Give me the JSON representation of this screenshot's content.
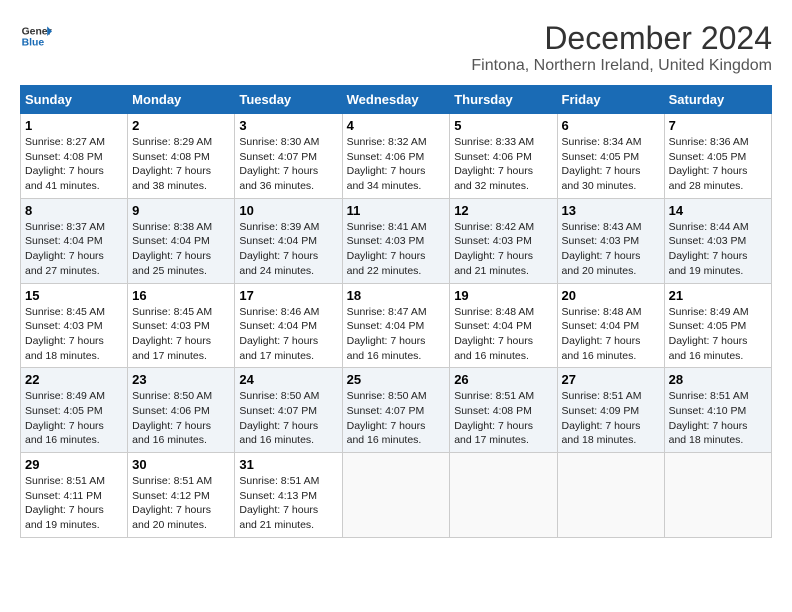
{
  "header": {
    "logo_general": "General",
    "logo_blue": "Blue",
    "month_title": "December 2024",
    "subtitle": "Fintona, Northern Ireland, United Kingdom"
  },
  "weekdays": [
    "Sunday",
    "Monday",
    "Tuesday",
    "Wednesday",
    "Thursday",
    "Friday",
    "Saturday"
  ],
  "weeks": [
    [
      {
        "day": "1",
        "sunrise": "Sunrise: 8:27 AM",
        "sunset": "Sunset: 4:08 PM",
        "daylight": "Daylight: 7 hours and 41 minutes."
      },
      {
        "day": "2",
        "sunrise": "Sunrise: 8:29 AM",
        "sunset": "Sunset: 4:08 PM",
        "daylight": "Daylight: 7 hours and 38 minutes."
      },
      {
        "day": "3",
        "sunrise": "Sunrise: 8:30 AM",
        "sunset": "Sunset: 4:07 PM",
        "daylight": "Daylight: 7 hours and 36 minutes."
      },
      {
        "day": "4",
        "sunrise": "Sunrise: 8:32 AM",
        "sunset": "Sunset: 4:06 PM",
        "daylight": "Daylight: 7 hours and 34 minutes."
      },
      {
        "day": "5",
        "sunrise": "Sunrise: 8:33 AM",
        "sunset": "Sunset: 4:06 PM",
        "daylight": "Daylight: 7 hours and 32 minutes."
      },
      {
        "day": "6",
        "sunrise": "Sunrise: 8:34 AM",
        "sunset": "Sunset: 4:05 PM",
        "daylight": "Daylight: 7 hours and 30 minutes."
      },
      {
        "day": "7",
        "sunrise": "Sunrise: 8:36 AM",
        "sunset": "Sunset: 4:05 PM",
        "daylight": "Daylight: 7 hours and 28 minutes."
      }
    ],
    [
      {
        "day": "8",
        "sunrise": "Sunrise: 8:37 AM",
        "sunset": "Sunset: 4:04 PM",
        "daylight": "Daylight: 7 hours and 27 minutes."
      },
      {
        "day": "9",
        "sunrise": "Sunrise: 8:38 AM",
        "sunset": "Sunset: 4:04 PM",
        "daylight": "Daylight: 7 hours and 25 minutes."
      },
      {
        "day": "10",
        "sunrise": "Sunrise: 8:39 AM",
        "sunset": "Sunset: 4:04 PM",
        "daylight": "Daylight: 7 hours and 24 minutes."
      },
      {
        "day": "11",
        "sunrise": "Sunrise: 8:41 AM",
        "sunset": "Sunset: 4:03 PM",
        "daylight": "Daylight: 7 hours and 22 minutes."
      },
      {
        "day": "12",
        "sunrise": "Sunrise: 8:42 AM",
        "sunset": "Sunset: 4:03 PM",
        "daylight": "Daylight: 7 hours and 21 minutes."
      },
      {
        "day": "13",
        "sunrise": "Sunrise: 8:43 AM",
        "sunset": "Sunset: 4:03 PM",
        "daylight": "Daylight: 7 hours and 20 minutes."
      },
      {
        "day": "14",
        "sunrise": "Sunrise: 8:44 AM",
        "sunset": "Sunset: 4:03 PM",
        "daylight": "Daylight: 7 hours and 19 minutes."
      }
    ],
    [
      {
        "day": "15",
        "sunrise": "Sunrise: 8:45 AM",
        "sunset": "Sunset: 4:03 PM",
        "daylight": "Daylight: 7 hours and 18 minutes."
      },
      {
        "day": "16",
        "sunrise": "Sunrise: 8:45 AM",
        "sunset": "Sunset: 4:03 PM",
        "daylight": "Daylight: 7 hours and 17 minutes."
      },
      {
        "day": "17",
        "sunrise": "Sunrise: 8:46 AM",
        "sunset": "Sunset: 4:04 PM",
        "daylight": "Daylight: 7 hours and 17 minutes."
      },
      {
        "day": "18",
        "sunrise": "Sunrise: 8:47 AM",
        "sunset": "Sunset: 4:04 PM",
        "daylight": "Daylight: 7 hours and 16 minutes."
      },
      {
        "day": "19",
        "sunrise": "Sunrise: 8:48 AM",
        "sunset": "Sunset: 4:04 PM",
        "daylight": "Daylight: 7 hours and 16 minutes."
      },
      {
        "day": "20",
        "sunrise": "Sunrise: 8:48 AM",
        "sunset": "Sunset: 4:04 PM",
        "daylight": "Daylight: 7 hours and 16 minutes."
      },
      {
        "day": "21",
        "sunrise": "Sunrise: 8:49 AM",
        "sunset": "Sunset: 4:05 PM",
        "daylight": "Daylight: 7 hours and 16 minutes."
      }
    ],
    [
      {
        "day": "22",
        "sunrise": "Sunrise: 8:49 AM",
        "sunset": "Sunset: 4:05 PM",
        "daylight": "Daylight: 7 hours and 16 minutes."
      },
      {
        "day": "23",
        "sunrise": "Sunrise: 8:50 AM",
        "sunset": "Sunset: 4:06 PM",
        "daylight": "Daylight: 7 hours and 16 minutes."
      },
      {
        "day": "24",
        "sunrise": "Sunrise: 8:50 AM",
        "sunset": "Sunset: 4:07 PM",
        "daylight": "Daylight: 7 hours and 16 minutes."
      },
      {
        "day": "25",
        "sunrise": "Sunrise: 8:50 AM",
        "sunset": "Sunset: 4:07 PM",
        "daylight": "Daylight: 7 hours and 16 minutes."
      },
      {
        "day": "26",
        "sunrise": "Sunrise: 8:51 AM",
        "sunset": "Sunset: 4:08 PM",
        "daylight": "Daylight: 7 hours and 17 minutes."
      },
      {
        "day": "27",
        "sunrise": "Sunrise: 8:51 AM",
        "sunset": "Sunset: 4:09 PM",
        "daylight": "Daylight: 7 hours and 18 minutes."
      },
      {
        "day": "28",
        "sunrise": "Sunrise: 8:51 AM",
        "sunset": "Sunset: 4:10 PM",
        "daylight": "Daylight: 7 hours and 18 minutes."
      }
    ],
    [
      {
        "day": "29",
        "sunrise": "Sunrise: 8:51 AM",
        "sunset": "Sunset: 4:11 PM",
        "daylight": "Daylight: 7 hours and 19 minutes."
      },
      {
        "day": "30",
        "sunrise": "Sunrise: 8:51 AM",
        "sunset": "Sunset: 4:12 PM",
        "daylight": "Daylight: 7 hours and 20 minutes."
      },
      {
        "day": "31",
        "sunrise": "Sunrise: 8:51 AM",
        "sunset": "Sunset: 4:13 PM",
        "daylight": "Daylight: 7 hours and 21 minutes."
      },
      null,
      null,
      null,
      null
    ]
  ]
}
